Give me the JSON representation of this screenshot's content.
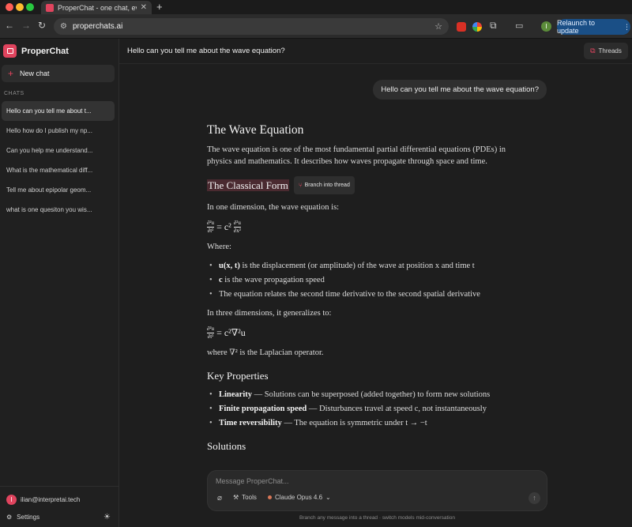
{
  "browser": {
    "tab_title": "ProperChat - one chat, every",
    "tab_close": "✕",
    "new_tab": "+",
    "url": "properchats.ai",
    "profile_initial": "I",
    "relaunch_label": "Relaunch to update",
    "relaunch_menu": "⋮"
  },
  "sidebar": {
    "brand": "ProperChat",
    "new_chat": "New chat",
    "chats_heading": "CHATS",
    "chats": [
      "Hello can you tell me about t...",
      "Hello how do I publish my np...",
      "Can you help me understand...",
      "What is the mathematical diff...",
      "Tell me about epipolar geom...",
      "what is one quesiton you wis..."
    ],
    "user_initial": "I",
    "user_email": "ilian@interpretai.tech",
    "settings": "Settings"
  },
  "header": {
    "title": "Hello can you tell me about the wave equation?",
    "threads": "Threads"
  },
  "conversation": {
    "user_message": "Hello can you tell me about the wave equation?",
    "answer": {
      "title": "The Wave Equation",
      "intro": "The wave equation is one of the most fundamental partial differential equations (PDEs) in physics and mathematics. It describes how waves propagate through space and time.",
      "section1": "The Classical Form",
      "branch_button": "Branch into thread",
      "one_dim": "In one dimension, the wave equation is:",
      "formula1": {
        "lhs_num": "∂²u",
        "lhs_den": "∂t²",
        "eq": "= c²",
        "rhs_num": "∂²u",
        "rhs_den": "∂x²"
      },
      "where": "Where:",
      "bullets1": [
        {
          "bold": "u(x, t)",
          "text": " is the displacement (or amplitude) of the wave at position x and time t"
        },
        {
          "bold": "c",
          "text": " is the wave propagation speed"
        },
        {
          "bold": "",
          "text": "The equation relates the second time derivative to the second spatial derivative"
        }
      ],
      "three_dim": "In three dimensions, it generalizes to:",
      "formula2": {
        "lhs_num": "∂²u",
        "lhs_den": "∂t²",
        "rhs": "= c²∇²u"
      },
      "laplacian": "where ∇² is the Laplacian operator.",
      "section2": "Key Properties",
      "bullets2": [
        {
          "bold": "Linearity",
          "text": " — Solutions can be superposed (added together) to form new solutions"
        },
        {
          "bold": "Finite propagation speed",
          "text": " — Disturbances travel at speed c, not instantaneously"
        },
        {
          "bold": "Time reversibility",
          "text": " — The equation is symmetric under t → −t"
        }
      ],
      "section3": "Solutions"
    }
  },
  "composer": {
    "placeholder": "Message ProperChat...",
    "tools": "Tools",
    "model": "Claude Opus 4.6",
    "hint": "Branch any message into a thread · switch models mid-conversation"
  },
  "colors": {
    "accent": "#e0445e",
    "background": "#1e1e1e",
    "sidebar": "#202020",
    "relaunch": "#1a4f86"
  },
  "icons": [
    "back-icon",
    "forward-icon",
    "reload-icon",
    "site-settings-icon",
    "bookmark-star-icon",
    "extensions-icon",
    "cast-icon",
    "plus-icon",
    "threads-icon",
    "branch-icon",
    "attach-icon",
    "tools-icon",
    "chevron-down-icon",
    "send-arrow-icon",
    "gear-icon",
    "sun-icon"
  ]
}
